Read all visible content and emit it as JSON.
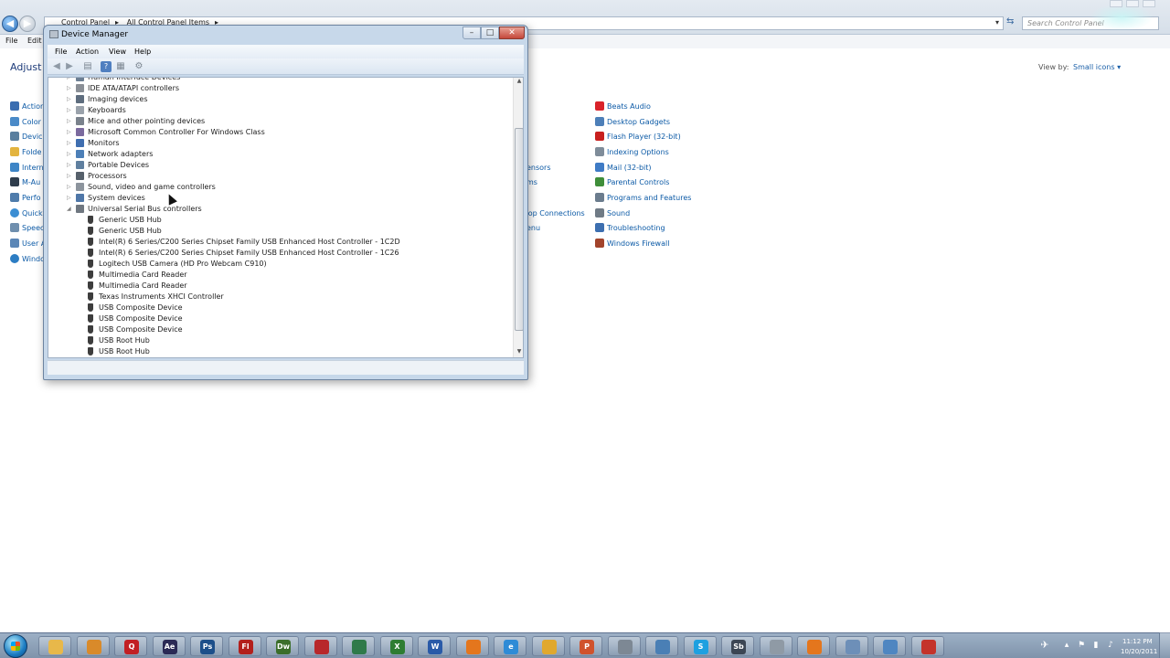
{
  "control_panel": {
    "breadcrumbs": [
      "Control Panel",
      "All Control Panel Items"
    ],
    "search_placeholder": "Search Control Panel",
    "menu": [
      "File",
      "Edit"
    ],
    "heading_partial": "Adjust y",
    "view_by_label": "View by:",
    "view_by_value": "Small icons",
    "left_items_partial": [
      "Action",
      "Color",
      "Device",
      "Folde",
      "Intern",
      "M-Au",
      "Perfo",
      "Quick",
      "Speec",
      "User A",
      "Windo"
    ],
    "middle_items_partial": [
      "ensors",
      "ms",
      "ktop Connections",
      "enu"
    ],
    "right_items": [
      {
        "label": "Beats Audio",
        "icon": "beats-audio-icon",
        "color": "#d9232a"
      },
      {
        "label": "Desktop Gadgets",
        "icon": "desktop-gadgets-icon",
        "color": "#4d7fb8"
      },
      {
        "label": "Flash Player (32-bit)",
        "icon": "flash-player-icon",
        "color": "#c8201e"
      },
      {
        "label": "Indexing Options",
        "icon": "indexing-options-icon",
        "color": "#7f8c99"
      },
      {
        "label": "Mail (32-bit)",
        "icon": "mail-icon",
        "color": "#3f7bc5"
      },
      {
        "label": "Parental Controls",
        "icon": "parental-controls-icon",
        "color": "#3f8e3a"
      },
      {
        "label": "Programs and Features",
        "icon": "programs-features-icon",
        "color": "#6b7c8d"
      },
      {
        "label": "Sound",
        "icon": "sound-icon",
        "color": "#707b86"
      },
      {
        "label": "Troubleshooting",
        "icon": "troubleshooting-icon",
        "color": "#3d6fb0"
      },
      {
        "label": "Windows Firewall",
        "icon": "windows-firewall-icon",
        "color": "#a2442c"
      }
    ]
  },
  "device_manager": {
    "title": "Device Manager",
    "close_glyph": "✕",
    "menu": [
      "File",
      "Action",
      "View",
      "Help"
    ],
    "tree": [
      {
        "label": "Human Interface Devices",
        "level": 0,
        "expanded": false,
        "icon_color": "#6c7f93"
      },
      {
        "label": "IDE ATA/ATAPI controllers",
        "level": 0,
        "expanded": false,
        "icon_color": "#8a8f96"
      },
      {
        "label": "Imaging devices",
        "level": 0,
        "expanded": false,
        "icon_color": "#5e6d7e"
      },
      {
        "label": "Keyboards",
        "level": 0,
        "expanded": false,
        "icon_color": "#9aa2ab"
      },
      {
        "label": "Mice and other pointing devices",
        "level": 0,
        "expanded": false,
        "icon_color": "#7a828c"
      },
      {
        "label": "Microsoft Common Controller For Windows Class",
        "level": 0,
        "expanded": false,
        "icon_color": "#7b6a9e"
      },
      {
        "label": "Monitors",
        "level": 0,
        "expanded": false,
        "icon_color": "#3f6eb0"
      },
      {
        "label": "Network adapters",
        "level": 0,
        "expanded": false,
        "icon_color": "#4c7fb7"
      },
      {
        "label": "Portable Devices",
        "level": 0,
        "expanded": false,
        "icon_color": "#5f7f9f"
      },
      {
        "label": "Processors",
        "level": 0,
        "expanded": false,
        "icon_color": "#56606b"
      },
      {
        "label": "Sound, video and game controllers",
        "level": 0,
        "expanded": false,
        "icon_color": "#8c949d"
      },
      {
        "label": "System devices",
        "level": 0,
        "expanded": false,
        "icon_color": "#4f77a8"
      },
      {
        "label": "Universal Serial Bus controllers",
        "level": 0,
        "expanded": true,
        "icon_color": "#6f7780"
      },
      {
        "label": "Generic USB Hub",
        "level": 1
      },
      {
        "label": "Generic USB Hub",
        "level": 1
      },
      {
        "label": "Intel(R) 6 Series/C200 Series Chipset Family USB Enhanced Host Controller - 1C2D",
        "level": 1
      },
      {
        "label": "Intel(R) 6 Series/C200 Series Chipset Family USB Enhanced Host Controller - 1C26",
        "level": 1
      },
      {
        "label": "Logitech USB Camera (HD Pro Webcam C910)",
        "level": 1
      },
      {
        "label": "Multimedia Card Reader",
        "level": 1
      },
      {
        "label": "Multimedia Card Reader",
        "level": 1
      },
      {
        "label": "Texas Instruments XHCI Controller",
        "level": 1
      },
      {
        "label": "USB Composite Device",
        "level": 1
      },
      {
        "label": "USB Composite Device",
        "level": 1
      },
      {
        "label": "USB Composite Device",
        "level": 1
      },
      {
        "label": "USB Root Hub",
        "level": 1
      },
      {
        "label": "USB Root Hub",
        "level": 1
      }
    ]
  },
  "taskbar": {
    "apps": [
      {
        "name": "explorer-icon",
        "glyph": "",
        "color": "#e8b84a"
      },
      {
        "name": "app-orange-icon",
        "glyph": "",
        "color": "#d98a2a"
      },
      {
        "name": "quicktime-icon",
        "glyph": "Q",
        "color": "#c21f24"
      },
      {
        "name": "after-effects-icon",
        "glyph": "Ae",
        "color": "#2b2a55"
      },
      {
        "name": "photoshop-icon",
        "glyph": "Ps",
        "color": "#1d4f8a"
      },
      {
        "name": "flash-icon",
        "glyph": "Fl",
        "color": "#b3201c"
      },
      {
        "name": "dreamweaver-icon",
        "glyph": "Dw",
        "color": "#3b6e2a"
      },
      {
        "name": "app-red-icon",
        "glyph": "",
        "color": "#b8282b"
      },
      {
        "name": "app-green-icon",
        "glyph": "",
        "color": "#2f7a4a"
      },
      {
        "name": "excel-icon",
        "glyph": "X",
        "color": "#2e7d32"
      },
      {
        "name": "word-icon",
        "glyph": "W",
        "color": "#2a5aa8"
      },
      {
        "name": "firefox-icon",
        "glyph": "",
        "color": "#e4761d"
      },
      {
        "name": "internet-explorer-icon",
        "glyph": "e",
        "color": "#2f8bd6"
      },
      {
        "name": "chrome-icon",
        "glyph": "",
        "color": "#e0a82e"
      },
      {
        "name": "powerpoint-icon",
        "glyph": "P",
        "color": "#d0522c"
      },
      {
        "name": "app-grey-icon",
        "glyph": "",
        "color": "#7d8894"
      },
      {
        "name": "app-blue-icon",
        "glyph": "",
        "color": "#4a7fb5"
      },
      {
        "name": "skype-icon",
        "glyph": "S",
        "color": "#1ea0e0"
      },
      {
        "name": "soundbooth-icon",
        "glyph": "Sb",
        "color": "#3c4654"
      },
      {
        "name": "app-disc-icon",
        "glyph": "",
        "color": "#8f9aa5"
      },
      {
        "name": "firefox-2-icon",
        "glyph": "",
        "color": "#e4761d"
      },
      {
        "name": "app-window-icon",
        "glyph": "",
        "color": "#6d8fb8"
      },
      {
        "name": "control-panel-icon",
        "glyph": "",
        "color": "#4f86c1"
      },
      {
        "name": "app-screen-icon",
        "glyph": "",
        "color": "#c4332b"
      }
    ],
    "clock_time": "11:12 PM",
    "clock_date": "10/20/2011"
  }
}
